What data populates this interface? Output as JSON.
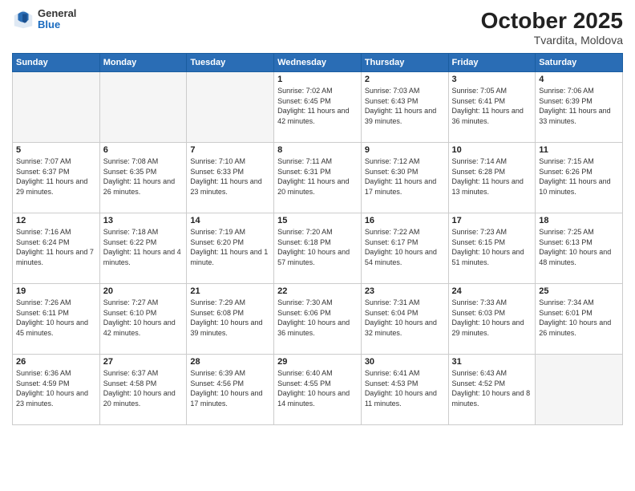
{
  "header": {
    "logo_general": "General",
    "logo_blue": "Blue",
    "month_title": "October 2025",
    "location": "Tvardita, Moldova"
  },
  "weekdays": [
    "Sunday",
    "Monday",
    "Tuesday",
    "Wednesday",
    "Thursday",
    "Friday",
    "Saturday"
  ],
  "weeks": [
    [
      {
        "day": "",
        "sunrise": "",
        "sunset": "",
        "daylight": ""
      },
      {
        "day": "",
        "sunrise": "",
        "sunset": "",
        "daylight": ""
      },
      {
        "day": "",
        "sunrise": "",
        "sunset": "",
        "daylight": ""
      },
      {
        "day": "1",
        "sunrise": "Sunrise: 7:02 AM",
        "sunset": "Sunset: 6:45 PM",
        "daylight": "Daylight: 11 hours and 42 minutes."
      },
      {
        "day": "2",
        "sunrise": "Sunrise: 7:03 AM",
        "sunset": "Sunset: 6:43 PM",
        "daylight": "Daylight: 11 hours and 39 minutes."
      },
      {
        "day": "3",
        "sunrise": "Sunrise: 7:05 AM",
        "sunset": "Sunset: 6:41 PM",
        "daylight": "Daylight: 11 hours and 36 minutes."
      },
      {
        "day": "4",
        "sunrise": "Sunrise: 7:06 AM",
        "sunset": "Sunset: 6:39 PM",
        "daylight": "Daylight: 11 hours and 33 minutes."
      }
    ],
    [
      {
        "day": "5",
        "sunrise": "Sunrise: 7:07 AM",
        "sunset": "Sunset: 6:37 PM",
        "daylight": "Daylight: 11 hours and 29 minutes."
      },
      {
        "day": "6",
        "sunrise": "Sunrise: 7:08 AM",
        "sunset": "Sunset: 6:35 PM",
        "daylight": "Daylight: 11 hours and 26 minutes."
      },
      {
        "day": "7",
        "sunrise": "Sunrise: 7:10 AM",
        "sunset": "Sunset: 6:33 PM",
        "daylight": "Daylight: 11 hours and 23 minutes."
      },
      {
        "day": "8",
        "sunrise": "Sunrise: 7:11 AM",
        "sunset": "Sunset: 6:31 PM",
        "daylight": "Daylight: 11 hours and 20 minutes."
      },
      {
        "day": "9",
        "sunrise": "Sunrise: 7:12 AM",
        "sunset": "Sunset: 6:30 PM",
        "daylight": "Daylight: 11 hours and 17 minutes."
      },
      {
        "day": "10",
        "sunrise": "Sunrise: 7:14 AM",
        "sunset": "Sunset: 6:28 PM",
        "daylight": "Daylight: 11 hours and 13 minutes."
      },
      {
        "day": "11",
        "sunrise": "Sunrise: 7:15 AM",
        "sunset": "Sunset: 6:26 PM",
        "daylight": "Daylight: 11 hours and 10 minutes."
      }
    ],
    [
      {
        "day": "12",
        "sunrise": "Sunrise: 7:16 AM",
        "sunset": "Sunset: 6:24 PM",
        "daylight": "Daylight: 11 hours and 7 minutes."
      },
      {
        "day": "13",
        "sunrise": "Sunrise: 7:18 AM",
        "sunset": "Sunset: 6:22 PM",
        "daylight": "Daylight: 11 hours and 4 minutes."
      },
      {
        "day": "14",
        "sunrise": "Sunrise: 7:19 AM",
        "sunset": "Sunset: 6:20 PM",
        "daylight": "Daylight: 11 hours and 1 minute."
      },
      {
        "day": "15",
        "sunrise": "Sunrise: 7:20 AM",
        "sunset": "Sunset: 6:18 PM",
        "daylight": "Daylight: 10 hours and 57 minutes."
      },
      {
        "day": "16",
        "sunrise": "Sunrise: 7:22 AM",
        "sunset": "Sunset: 6:17 PM",
        "daylight": "Daylight: 10 hours and 54 minutes."
      },
      {
        "day": "17",
        "sunrise": "Sunrise: 7:23 AM",
        "sunset": "Sunset: 6:15 PM",
        "daylight": "Daylight: 10 hours and 51 minutes."
      },
      {
        "day": "18",
        "sunrise": "Sunrise: 7:25 AM",
        "sunset": "Sunset: 6:13 PM",
        "daylight": "Daylight: 10 hours and 48 minutes."
      }
    ],
    [
      {
        "day": "19",
        "sunrise": "Sunrise: 7:26 AM",
        "sunset": "Sunset: 6:11 PM",
        "daylight": "Daylight: 10 hours and 45 minutes."
      },
      {
        "day": "20",
        "sunrise": "Sunrise: 7:27 AM",
        "sunset": "Sunset: 6:10 PM",
        "daylight": "Daylight: 10 hours and 42 minutes."
      },
      {
        "day": "21",
        "sunrise": "Sunrise: 7:29 AM",
        "sunset": "Sunset: 6:08 PM",
        "daylight": "Daylight: 10 hours and 39 minutes."
      },
      {
        "day": "22",
        "sunrise": "Sunrise: 7:30 AM",
        "sunset": "Sunset: 6:06 PM",
        "daylight": "Daylight: 10 hours and 36 minutes."
      },
      {
        "day": "23",
        "sunrise": "Sunrise: 7:31 AM",
        "sunset": "Sunset: 6:04 PM",
        "daylight": "Daylight: 10 hours and 32 minutes."
      },
      {
        "day": "24",
        "sunrise": "Sunrise: 7:33 AM",
        "sunset": "Sunset: 6:03 PM",
        "daylight": "Daylight: 10 hours and 29 minutes."
      },
      {
        "day": "25",
        "sunrise": "Sunrise: 7:34 AM",
        "sunset": "Sunset: 6:01 PM",
        "daylight": "Daylight: 10 hours and 26 minutes."
      }
    ],
    [
      {
        "day": "26",
        "sunrise": "Sunrise: 6:36 AM",
        "sunset": "Sunset: 4:59 PM",
        "daylight": "Daylight: 10 hours and 23 minutes."
      },
      {
        "day": "27",
        "sunrise": "Sunrise: 6:37 AM",
        "sunset": "Sunset: 4:58 PM",
        "daylight": "Daylight: 10 hours and 20 minutes."
      },
      {
        "day": "28",
        "sunrise": "Sunrise: 6:39 AM",
        "sunset": "Sunset: 4:56 PM",
        "daylight": "Daylight: 10 hours and 17 minutes."
      },
      {
        "day": "29",
        "sunrise": "Sunrise: 6:40 AM",
        "sunset": "Sunset: 4:55 PM",
        "daylight": "Daylight: 10 hours and 14 minutes."
      },
      {
        "day": "30",
        "sunrise": "Sunrise: 6:41 AM",
        "sunset": "Sunset: 4:53 PM",
        "daylight": "Daylight: 10 hours and 11 minutes."
      },
      {
        "day": "31",
        "sunrise": "Sunrise: 6:43 AM",
        "sunset": "Sunset: 4:52 PM",
        "daylight": "Daylight: 10 hours and 8 minutes."
      },
      {
        "day": "",
        "sunrise": "",
        "sunset": "",
        "daylight": ""
      }
    ]
  ]
}
